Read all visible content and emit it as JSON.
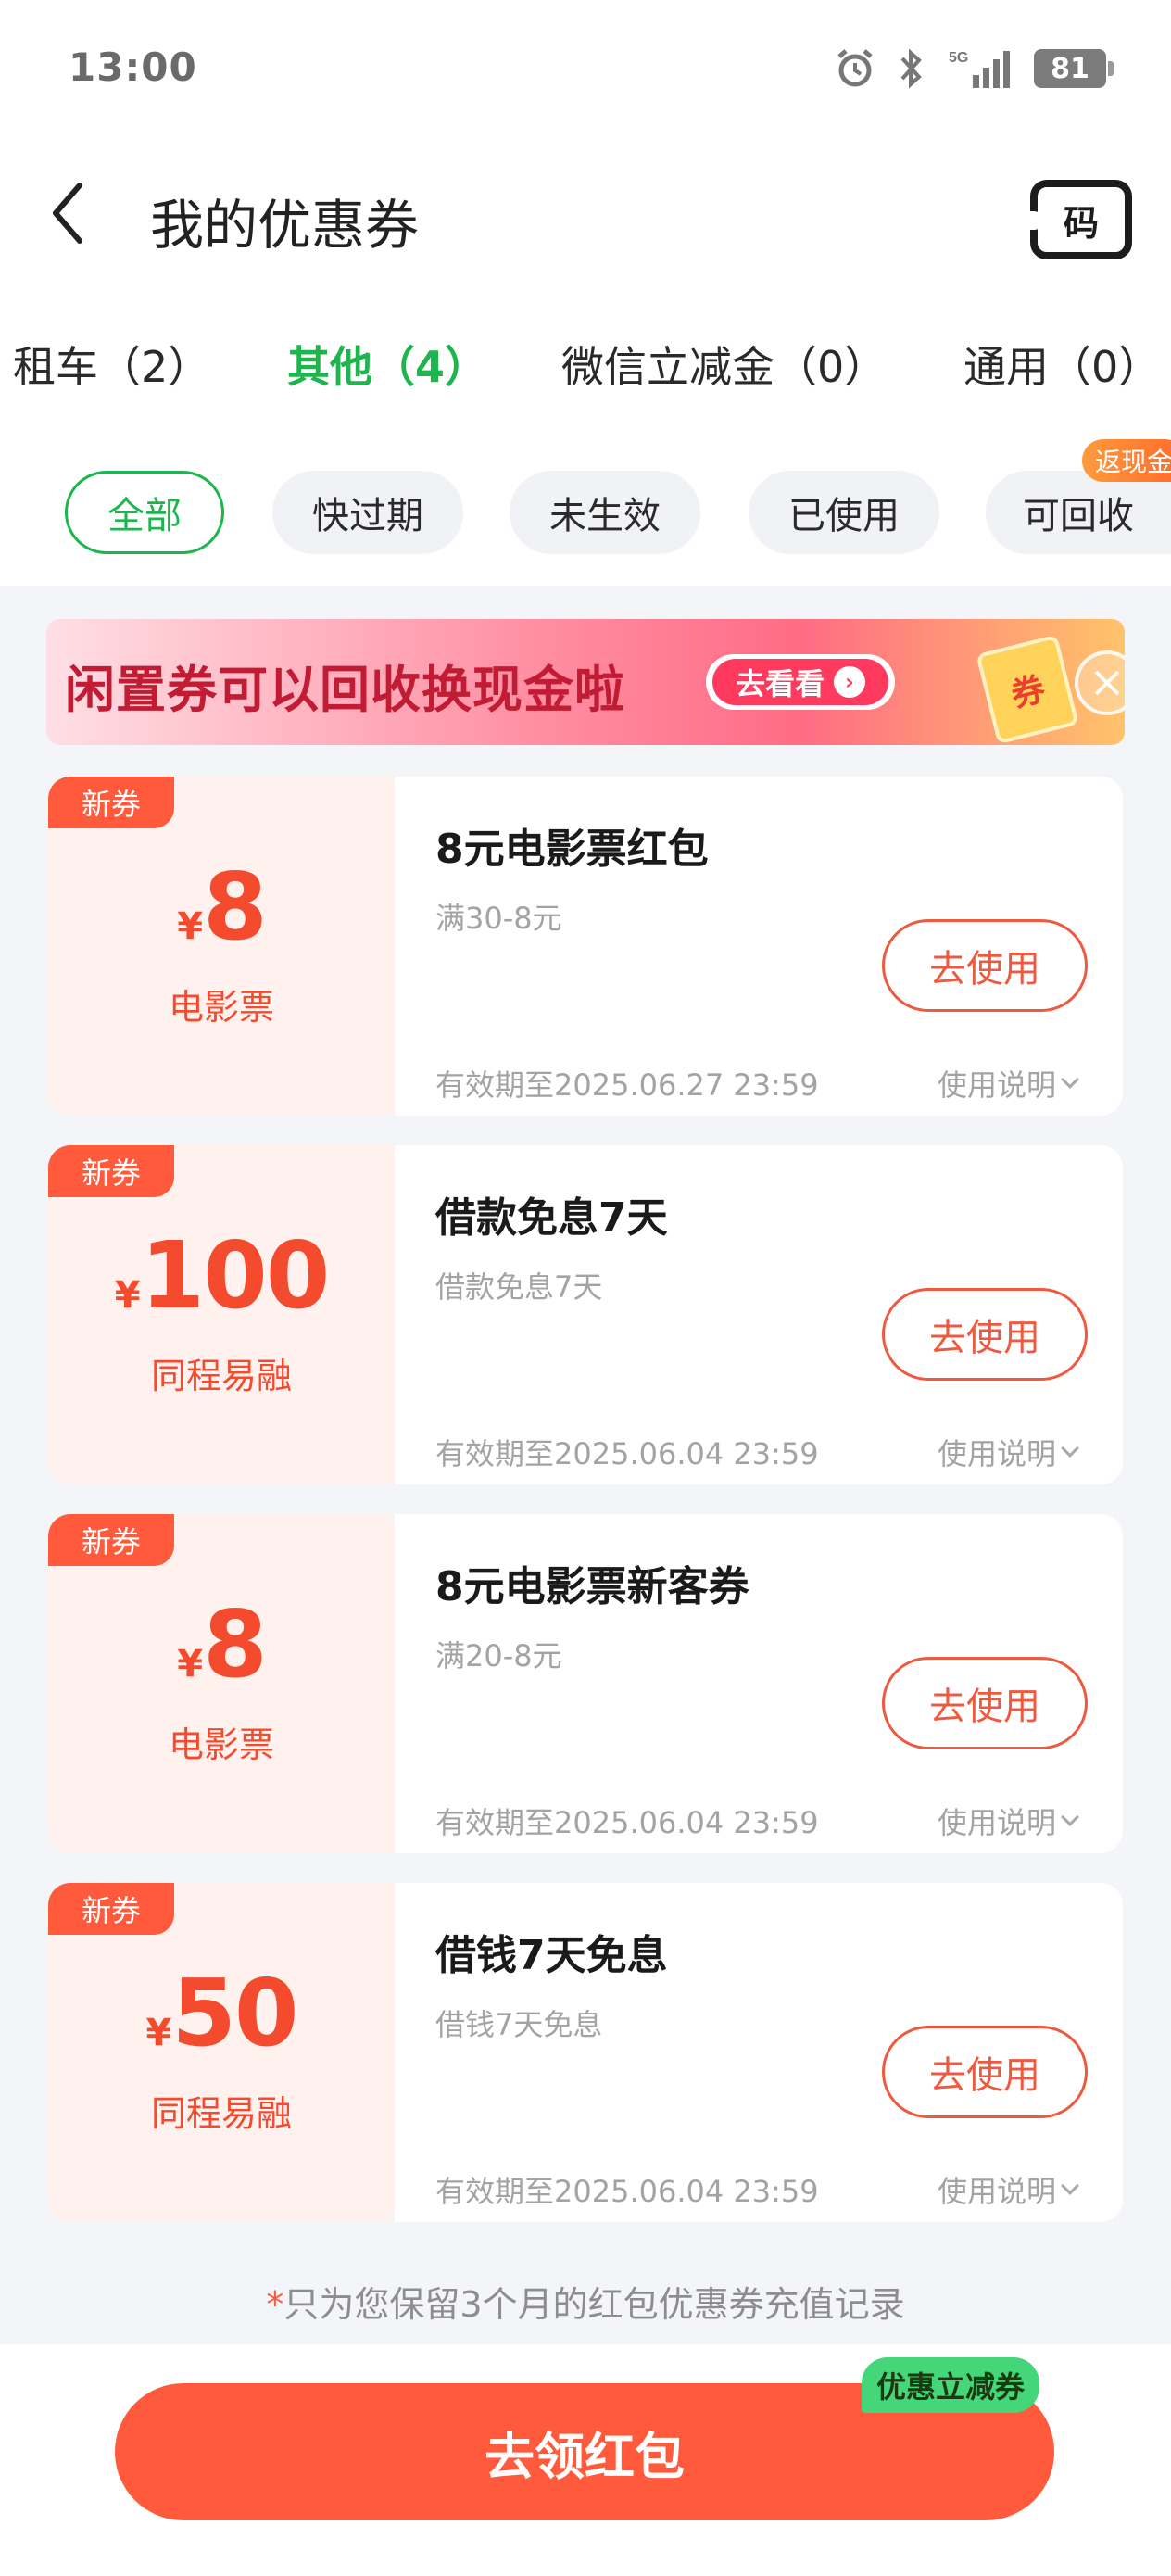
{
  "status_bar": {
    "time": "13:00",
    "network": "5G",
    "battery": "81"
  },
  "header": {
    "title": "我的优惠券",
    "code_button": "码"
  },
  "tabs": [
    {
      "label": "租车（2）"
    },
    {
      "label": "其他（4）"
    },
    {
      "label": "微信立减金（0）"
    },
    {
      "label": "通用（0）"
    }
  ],
  "filters": [
    {
      "label": "全部"
    },
    {
      "label": "快过期"
    },
    {
      "label": "未生效"
    },
    {
      "label": "已使用"
    },
    {
      "label": "可回收"
    }
  ],
  "filter_badge": "返现金",
  "banner": {
    "text": "闲置券可以回收换现金啦",
    "cta": "去看看",
    "ticket": "券"
  },
  "coupons": [
    {
      "badge": "新券",
      "currency": "¥",
      "amount": "8",
      "category": "电影票",
      "title": "8元电影票红包",
      "subtitle": "满30-8元",
      "button": "去使用",
      "expiry": "有效期至2025.06.27 23:59",
      "help": "使用说明"
    },
    {
      "badge": "新券",
      "currency": "¥",
      "amount": "100",
      "category": "同程易融",
      "title": "借款免息7天",
      "subtitle": "借款免息7天",
      "button": "去使用",
      "expiry": "有效期至2025.06.04 23:59",
      "help": "使用说明"
    },
    {
      "badge": "新券",
      "currency": "¥",
      "amount": "8",
      "category": "电影票",
      "title": "8元电影票新客券",
      "subtitle": "满20-8元",
      "button": "去使用",
      "expiry": "有效期至2025.06.04 23:59",
      "help": "使用说明"
    },
    {
      "badge": "新券",
      "currency": "¥",
      "amount": "50",
      "category": "同程易融",
      "title": "借钱7天免息",
      "subtitle": "借钱7天免息",
      "button": "去使用",
      "expiry": "有效期至2025.06.04 23:59",
      "help": "使用说明"
    }
  ],
  "footnote": {
    "star": "*",
    "text": "只为您保留3个月的红包优惠券充值记录"
  },
  "bottom": {
    "cta": "去领红包",
    "tag": "优惠立减券"
  },
  "colors": {
    "accent_green": "#1fb54e",
    "coupon_red": "#f44a2e",
    "cta_orange": "#ff5a3c"
  }
}
